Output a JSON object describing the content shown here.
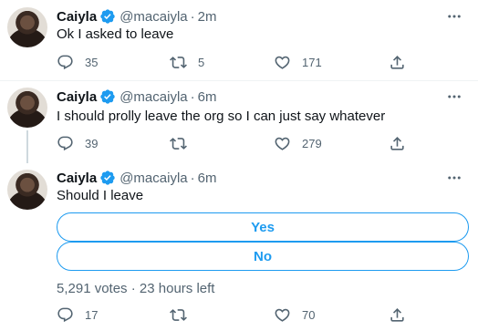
{
  "tweets": [
    {
      "name": "Caiyla",
      "handle": "@macaiyla",
      "dot": "·",
      "time": "2m",
      "text": "Ok I asked to leave",
      "replies": "35",
      "retweets": "5",
      "likes": "171"
    },
    {
      "name": "Caiyla",
      "handle": "@macaiyla",
      "dot": "·",
      "time": "6m",
      "text": "I should prolly leave the org so I can just say whatever",
      "replies": "39",
      "retweets": "",
      "likes": "279"
    },
    {
      "name": "Caiyla",
      "handle": "@macaiyla",
      "dot": "·",
      "time": "6m",
      "text": "Should I leave",
      "poll": {
        "options": [
          "Yes",
          "No"
        ],
        "votes": "5,291 votes",
        "dot": "·",
        "time_left": "23 hours left"
      },
      "replies": "17",
      "retweets": "",
      "likes": "70"
    }
  ],
  "colors": {
    "accent": "#1d9bf0",
    "secondary_text": "#536471",
    "divider": "#eff3f4"
  }
}
